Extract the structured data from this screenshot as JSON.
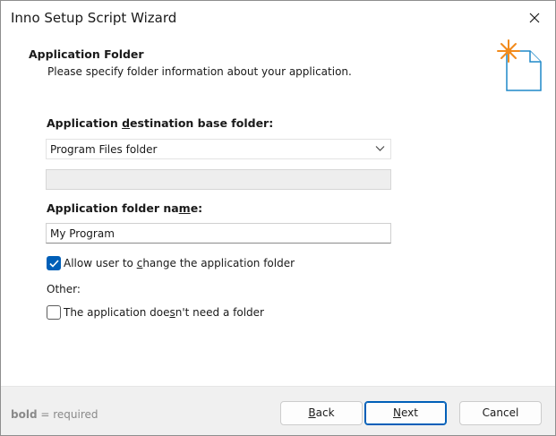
{
  "window": {
    "title": "Inno Setup Script Wizard"
  },
  "header": {
    "title": "Application Folder",
    "subtitle": "Please specify folder information about your application."
  },
  "form": {
    "base_folder_label_pre": "Application ",
    "base_folder_label_u": "d",
    "base_folder_label_post": "estination base folder:",
    "base_folder_value": "Program Files folder",
    "custom_folder_value": "",
    "folder_name_label_pre": "Application folder na",
    "folder_name_label_u": "m",
    "folder_name_label_post": "e:",
    "folder_name_value": "My Program",
    "allow_change": {
      "pre": "Allow user to ",
      "u": "c",
      "post": "hange the application folder",
      "checked": true
    },
    "other_label": "Other:",
    "no_folder": {
      "pre": "The application doe",
      "u": "s",
      "post": "n't need a folder",
      "checked": false
    }
  },
  "footer": {
    "hint_bold": "bold",
    "hint_rest": " = required",
    "back": {
      "u": "B",
      "post": "ack"
    },
    "next": {
      "u": "N",
      "post": "ext"
    },
    "cancel": "Cancel"
  },
  "colors": {
    "accent": "#005fb8",
    "footer_bg": "#f0f0f0",
    "star": "#f28b1c",
    "page_icon": "#1e88c8"
  },
  "icons": [
    "close-icon",
    "chevron-down-icon",
    "checkmark-icon",
    "new-document-icon"
  ]
}
